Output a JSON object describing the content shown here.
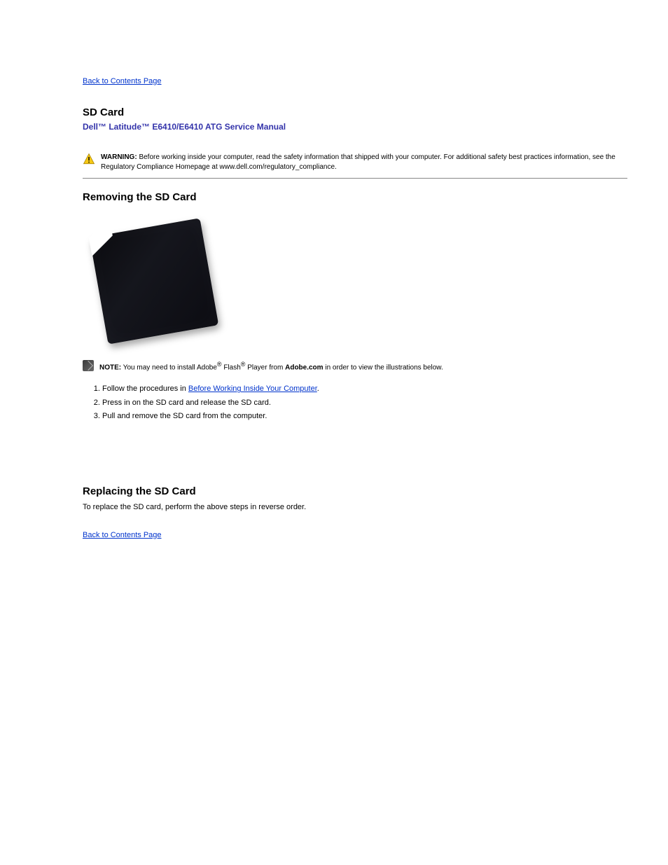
{
  "links": {
    "toc_top": "Back to Contents Page",
    "toc_bottom": "Back to Contents Page",
    "before_working": "Before Working Inside Your Computer"
  },
  "title": {
    "topic": "SD Card",
    "subtitle": "Dell™ Latitude™ E6410/E6410 ATG Service Manual"
  },
  "warning": {
    "label": "WARNING:",
    "text": "Before working inside your computer, read the safety information that shipped with your computer. For additional safety best practices information, see the Regulatory Compliance Homepage at www.dell.com/regulatory_compliance."
  },
  "sections": {
    "removing": "Removing the SD Card",
    "replacing": "Replacing the SD Card"
  },
  "note": {
    "label": "NOTE:",
    "prefix": "You may need to install Adobe",
    "flash_word": " Flash",
    "player_word": " Player from ",
    "adobe_site": "Adobe.com",
    "suffix": " in order to view the illustrations below."
  },
  "steps": {
    "s1_prefix": "Follow the procedures in ",
    "s1_suffix": ".",
    "s2": "Press in on the SD card and release the SD card.",
    "s3": "Pull and remove the SD card from the computer."
  },
  "replace_text": "To replace the SD card, perform the above steps in reverse order.",
  "icons": {
    "warning": "warning-triangle-icon",
    "note": "note-pencil-icon",
    "component": "sd-card-image"
  }
}
